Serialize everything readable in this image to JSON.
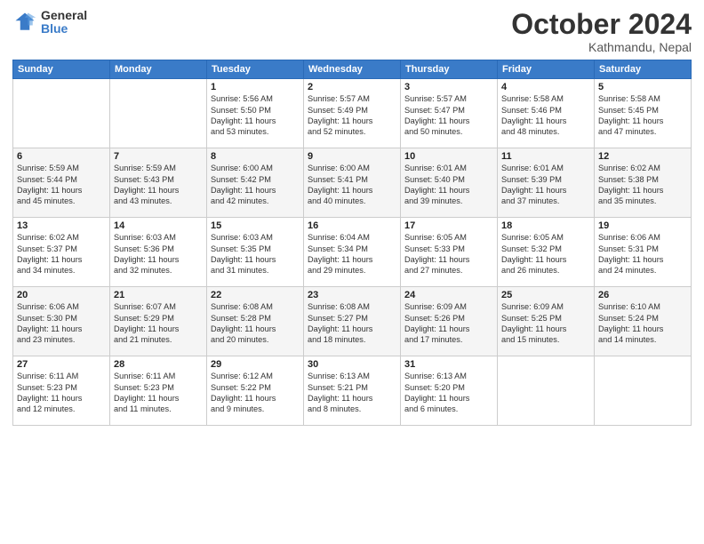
{
  "logo": {
    "general": "General",
    "blue": "Blue"
  },
  "title": "October 2024",
  "subtitle": "Kathmandu, Nepal",
  "header_days": [
    "Sunday",
    "Monday",
    "Tuesday",
    "Wednesday",
    "Thursday",
    "Friday",
    "Saturday"
  ],
  "weeks": [
    [
      {
        "day": "",
        "info": ""
      },
      {
        "day": "",
        "info": ""
      },
      {
        "day": "1",
        "info": "Sunrise: 5:56 AM\nSunset: 5:50 PM\nDaylight: 11 hours\nand 53 minutes."
      },
      {
        "day": "2",
        "info": "Sunrise: 5:57 AM\nSunset: 5:49 PM\nDaylight: 11 hours\nand 52 minutes."
      },
      {
        "day": "3",
        "info": "Sunrise: 5:57 AM\nSunset: 5:47 PM\nDaylight: 11 hours\nand 50 minutes."
      },
      {
        "day": "4",
        "info": "Sunrise: 5:58 AM\nSunset: 5:46 PM\nDaylight: 11 hours\nand 48 minutes."
      },
      {
        "day": "5",
        "info": "Sunrise: 5:58 AM\nSunset: 5:45 PM\nDaylight: 11 hours\nand 47 minutes."
      }
    ],
    [
      {
        "day": "6",
        "info": "Sunrise: 5:59 AM\nSunset: 5:44 PM\nDaylight: 11 hours\nand 45 minutes."
      },
      {
        "day": "7",
        "info": "Sunrise: 5:59 AM\nSunset: 5:43 PM\nDaylight: 11 hours\nand 43 minutes."
      },
      {
        "day": "8",
        "info": "Sunrise: 6:00 AM\nSunset: 5:42 PM\nDaylight: 11 hours\nand 42 minutes."
      },
      {
        "day": "9",
        "info": "Sunrise: 6:00 AM\nSunset: 5:41 PM\nDaylight: 11 hours\nand 40 minutes."
      },
      {
        "day": "10",
        "info": "Sunrise: 6:01 AM\nSunset: 5:40 PM\nDaylight: 11 hours\nand 39 minutes."
      },
      {
        "day": "11",
        "info": "Sunrise: 6:01 AM\nSunset: 5:39 PM\nDaylight: 11 hours\nand 37 minutes."
      },
      {
        "day": "12",
        "info": "Sunrise: 6:02 AM\nSunset: 5:38 PM\nDaylight: 11 hours\nand 35 minutes."
      }
    ],
    [
      {
        "day": "13",
        "info": "Sunrise: 6:02 AM\nSunset: 5:37 PM\nDaylight: 11 hours\nand 34 minutes."
      },
      {
        "day": "14",
        "info": "Sunrise: 6:03 AM\nSunset: 5:36 PM\nDaylight: 11 hours\nand 32 minutes."
      },
      {
        "day": "15",
        "info": "Sunrise: 6:03 AM\nSunset: 5:35 PM\nDaylight: 11 hours\nand 31 minutes."
      },
      {
        "day": "16",
        "info": "Sunrise: 6:04 AM\nSunset: 5:34 PM\nDaylight: 11 hours\nand 29 minutes."
      },
      {
        "day": "17",
        "info": "Sunrise: 6:05 AM\nSunset: 5:33 PM\nDaylight: 11 hours\nand 27 minutes."
      },
      {
        "day": "18",
        "info": "Sunrise: 6:05 AM\nSunset: 5:32 PM\nDaylight: 11 hours\nand 26 minutes."
      },
      {
        "day": "19",
        "info": "Sunrise: 6:06 AM\nSunset: 5:31 PM\nDaylight: 11 hours\nand 24 minutes."
      }
    ],
    [
      {
        "day": "20",
        "info": "Sunrise: 6:06 AM\nSunset: 5:30 PM\nDaylight: 11 hours\nand 23 minutes."
      },
      {
        "day": "21",
        "info": "Sunrise: 6:07 AM\nSunset: 5:29 PM\nDaylight: 11 hours\nand 21 minutes."
      },
      {
        "day": "22",
        "info": "Sunrise: 6:08 AM\nSunset: 5:28 PM\nDaylight: 11 hours\nand 20 minutes."
      },
      {
        "day": "23",
        "info": "Sunrise: 6:08 AM\nSunset: 5:27 PM\nDaylight: 11 hours\nand 18 minutes."
      },
      {
        "day": "24",
        "info": "Sunrise: 6:09 AM\nSunset: 5:26 PM\nDaylight: 11 hours\nand 17 minutes."
      },
      {
        "day": "25",
        "info": "Sunrise: 6:09 AM\nSunset: 5:25 PM\nDaylight: 11 hours\nand 15 minutes."
      },
      {
        "day": "26",
        "info": "Sunrise: 6:10 AM\nSunset: 5:24 PM\nDaylight: 11 hours\nand 14 minutes."
      }
    ],
    [
      {
        "day": "27",
        "info": "Sunrise: 6:11 AM\nSunset: 5:23 PM\nDaylight: 11 hours\nand 12 minutes."
      },
      {
        "day": "28",
        "info": "Sunrise: 6:11 AM\nSunset: 5:23 PM\nDaylight: 11 hours\nand 11 minutes."
      },
      {
        "day": "29",
        "info": "Sunrise: 6:12 AM\nSunset: 5:22 PM\nDaylight: 11 hours\nand 9 minutes."
      },
      {
        "day": "30",
        "info": "Sunrise: 6:13 AM\nSunset: 5:21 PM\nDaylight: 11 hours\nand 8 minutes."
      },
      {
        "day": "31",
        "info": "Sunrise: 6:13 AM\nSunset: 5:20 PM\nDaylight: 11 hours\nand 6 minutes."
      },
      {
        "day": "",
        "info": ""
      },
      {
        "day": "",
        "info": ""
      }
    ]
  ]
}
